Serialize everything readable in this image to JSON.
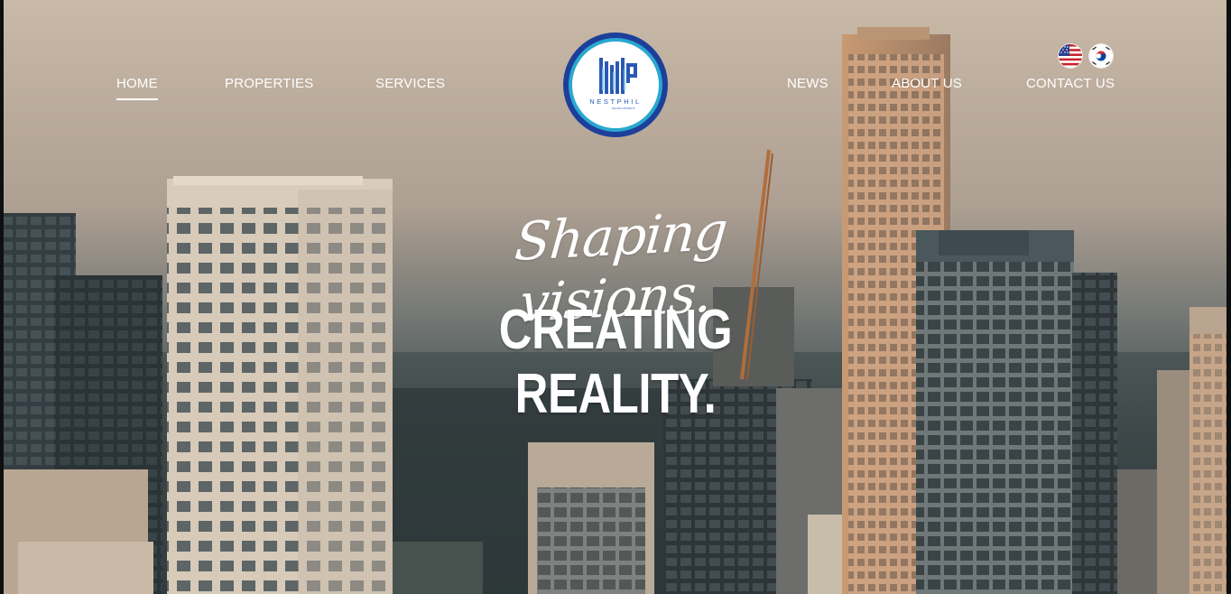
{
  "nav": {
    "left": [
      {
        "label": "HOME",
        "active": true
      },
      {
        "label": "PROPERTIES",
        "active": false
      },
      {
        "label": "SERVICES",
        "active": false
      }
    ],
    "right": [
      {
        "label": "NEWS",
        "active": false
      },
      {
        "label": "ABOUT US",
        "active": false
      },
      {
        "label": "CONTACT US",
        "active": false
      }
    ]
  },
  "logo": {
    "brand": "NESTPHIL",
    "sub": "DEVELOPMENT",
    "colors": {
      "outer": "#1d3f9a",
      "ring": "#2aa8cf",
      "mark": "#2a58b5"
    }
  },
  "languages": [
    {
      "name": "us-flag-icon",
      "code": "en"
    },
    {
      "name": "korea-flag-icon",
      "code": "ko"
    }
  ],
  "hero": {
    "script_line": "Shaping visions.",
    "main_line": "CREATING REALITY."
  }
}
